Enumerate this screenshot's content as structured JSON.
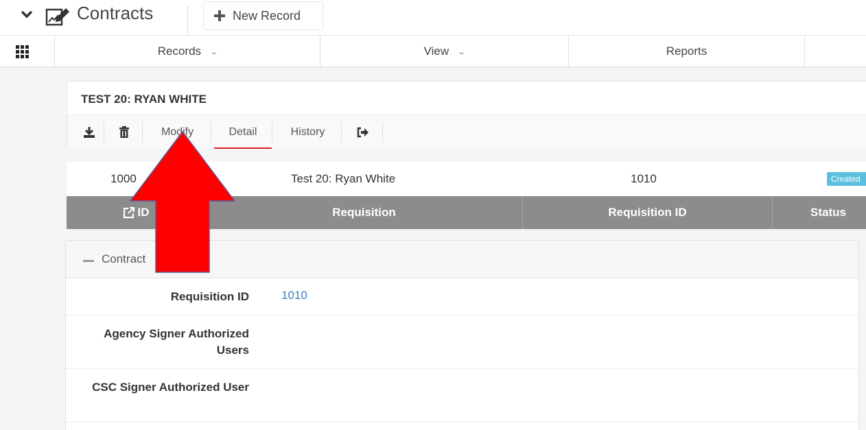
{
  "app": {
    "title": "Contracts",
    "new_record_label": "New Record"
  },
  "nav": {
    "items": [
      {
        "label": "Records",
        "has_caret": true
      },
      {
        "label": "View",
        "has_caret": true
      },
      {
        "label": "Reports",
        "has_caret": false
      }
    ],
    "caret_glyph": "⌄"
  },
  "record": {
    "title": "TEST 20: RYAN WHITE",
    "toolbar": {
      "download_icon": "download-icon",
      "delete_icon": "trash-icon",
      "modify_label": "Modify",
      "detail_label": "Detail",
      "history_label": "History",
      "exit_icon": "sign-out-icon"
    }
  },
  "summary": {
    "id": "1000",
    "requisition": "Test 20: Ryan White",
    "requisition_id": "1010",
    "status": "Created"
  },
  "table_header": {
    "id": "ID",
    "requisition": "Requisition",
    "requisition_id": "Requisition ID",
    "status": "Status"
  },
  "panel": {
    "title": "Contract",
    "fields": [
      {
        "label": "Requisition ID",
        "value": "1010"
      },
      {
        "label": "Agency Signer Authorized Users",
        "value": ""
      },
      {
        "label": "CSC Signer Authorized User",
        "value": ""
      }
    ]
  },
  "colors": {
    "status_badge": "#5bc0de",
    "header_bg": "#8c8c8c",
    "active_tab_underline": "#e02020",
    "annotation_arrow": "#ff0000",
    "link": "#3b7cc1"
  }
}
